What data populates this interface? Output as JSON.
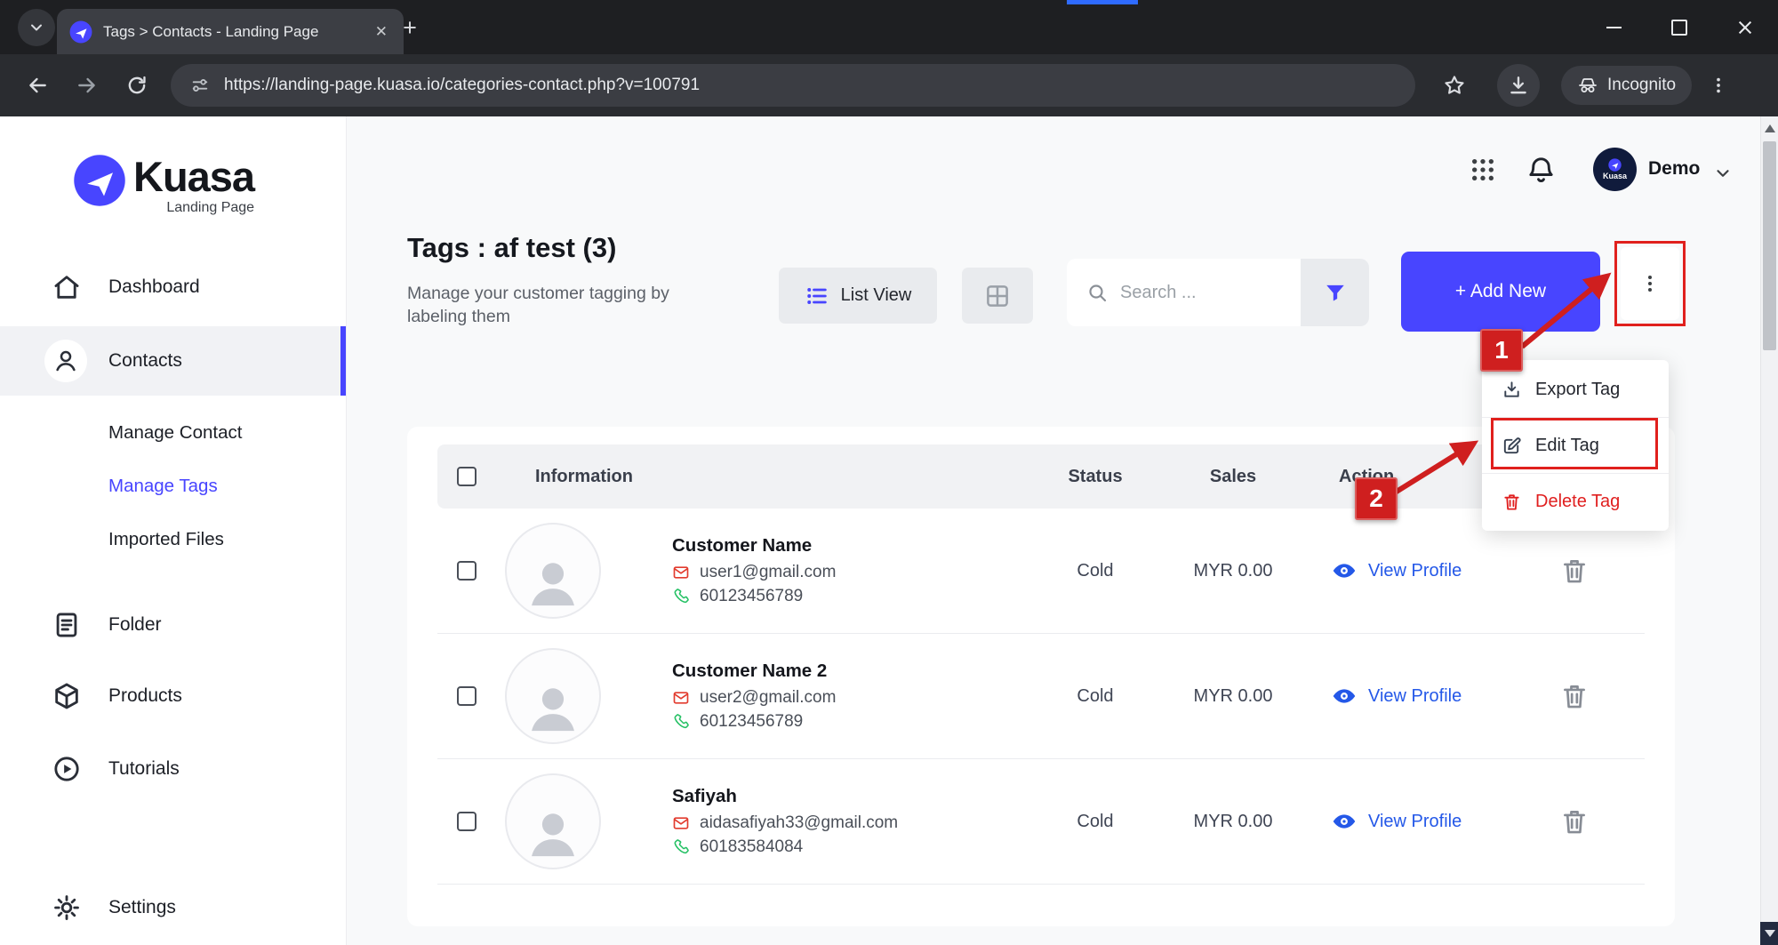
{
  "browser": {
    "tab_title": "Tags > Contacts - Landing Page",
    "url": "https://landing-page.kuasa.io/categories-contact.php?v=100791",
    "incognito_label": "Incognito"
  },
  "icons": {
    "close_tab_glyph": "✕",
    "new_tab_glyph": "+"
  },
  "sidebar": {
    "logo_text": "Kuasa",
    "logo_subtitle": "Landing Page",
    "items": [
      {
        "label": "Dashboard"
      },
      {
        "label": "Contacts"
      },
      {
        "label": "Manage Contact"
      },
      {
        "label": "Manage Tags"
      },
      {
        "label": "Imported Files"
      },
      {
        "label": "Folder"
      },
      {
        "label": "Products"
      },
      {
        "label": "Tutorials"
      },
      {
        "label": "Settings"
      }
    ]
  },
  "topbar": {
    "user_name": "Demo",
    "avatar_label": "Kuasa"
  },
  "page": {
    "title": "Tags : af test (3)",
    "subtitle": "Manage your customer tagging by labeling them",
    "list_view": "List View",
    "search_placeholder": "Search ...",
    "add_new": "+ Add New"
  },
  "menu": {
    "export": "Export Tag",
    "edit": "Edit Tag",
    "delete": "Delete Tag"
  },
  "annotations": {
    "step1": "1",
    "step2": "2"
  },
  "table": {
    "headers": {
      "information": "Information",
      "status": "Status",
      "sales": "Sales",
      "action": "Action"
    },
    "rows": [
      {
        "name": "Customer Name",
        "email": "user1@gmail.com",
        "phone": "60123456789",
        "status": "Cold",
        "sales": "MYR 0.00",
        "action": "View Profile"
      },
      {
        "name": "Customer Name 2",
        "email": "user2@gmail.com",
        "phone": "60123456789",
        "status": "Cold",
        "sales": "MYR 0.00",
        "action": "View Profile"
      },
      {
        "name": "Safiyah",
        "email": "aidasafiyah33@gmail.com",
        "phone": "60183584084",
        "status": "Cold",
        "sales": "MYR 0.00",
        "action": "View Profile"
      }
    ]
  },
  "colors": {
    "accent_blue": "#4845ff",
    "link_blue": "#2458e8",
    "annotation_red": "#cf1f1f",
    "danger_red": "#e01f1f",
    "success_green": "#26c165",
    "brand_navy": "#101b3c"
  }
}
